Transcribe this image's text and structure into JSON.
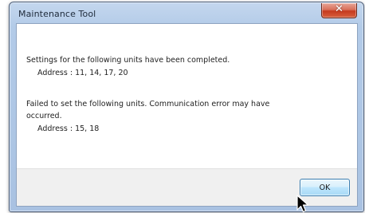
{
  "dialog": {
    "title": "Maintenance Tool",
    "close_glyph": "✕"
  },
  "messages": {
    "success_line": "Settings for the following units have been completed.",
    "success_address": "Address : 11, 14, 17, 20",
    "failure_line1": "Failed to set the following units. Communication error may have",
    "failure_line2": "occurred.",
    "failure_address": "Address : 15, 18"
  },
  "buttons": {
    "ok_label": "OK"
  },
  "colors": {
    "title_bar": "#b3cbe8",
    "close_button": "#c63a1f",
    "ok_button_border": "#3c7fb1"
  },
  "icons": {
    "close": "close-icon",
    "cursor": "mouse-pointer-icon"
  }
}
